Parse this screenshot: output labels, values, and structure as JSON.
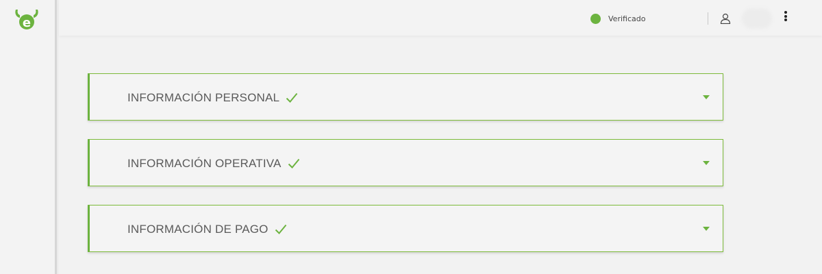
{
  "header": {
    "logo": "etoro-bull-logo",
    "status_label": "Verificado",
    "status_color": "#6cb33f",
    "user_icon": "user-icon",
    "menu_icon": "more-vertical-icon"
  },
  "sections": [
    {
      "title": "INFORMACIÓN PERSONAL",
      "completed": true,
      "icon": "check-icon"
    },
    {
      "title": "INFORMACIÓN OPERATIVA",
      "completed": true,
      "icon": "check-icon"
    },
    {
      "title": "INFORMACIÓN DE PAGO",
      "completed": true,
      "icon": "check-icon"
    }
  ],
  "colors": {
    "accent": "#6cb33f",
    "background": "#f2f2f2",
    "text": "#5a5a5a"
  }
}
